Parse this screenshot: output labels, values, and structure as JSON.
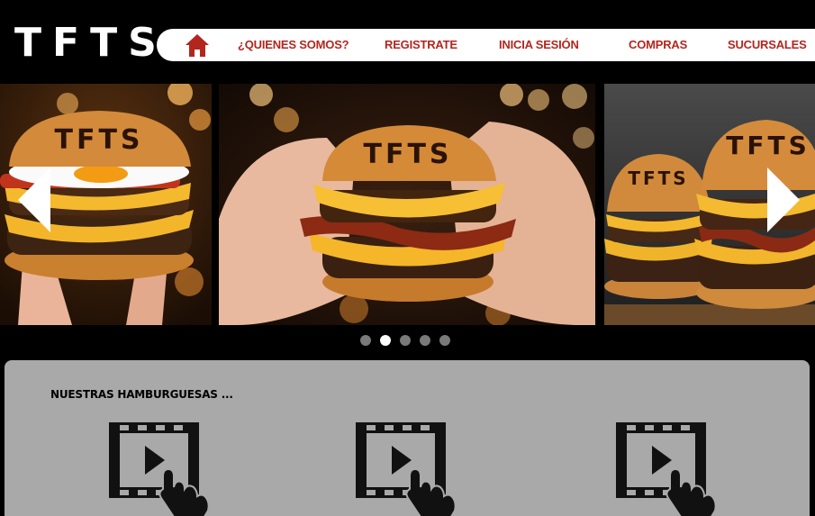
{
  "header": {
    "logo": "TFTS",
    "nav": {
      "home_icon": "home-icon",
      "items": [
        "¿QUIENES SOMOS?",
        "REGISTRATE",
        "INICIA SESIÓN",
        "COMPRAS",
        "SUCURSALES"
      ]
    }
  },
  "carousel": {
    "slides": [
      {
        "bun_text": "TFTS",
        "description": "burger with fried egg held in hand"
      },
      {
        "bun_text": "TFTS",
        "description": "bacon cheeseburger held with two hands"
      },
      {
        "bun_text": "TFTS",
        "description": "stacked double cheeseburgers"
      }
    ],
    "prev_icon": "chevron-left-icon",
    "next_icon": "chevron-right-icon",
    "dot_count": 5,
    "active_dot": 2
  },
  "section": {
    "title": "NUESTRAS HAMBURGUESAS ...",
    "videos": [
      {
        "icon": "video-play-touch-icon"
      },
      {
        "icon": "video-play-touch-icon"
      },
      {
        "icon": "video-play-touch-icon"
      }
    ]
  },
  "colors": {
    "background": "#000000",
    "nav_text": "#b3261e",
    "panel": "#a9a9a9"
  }
}
